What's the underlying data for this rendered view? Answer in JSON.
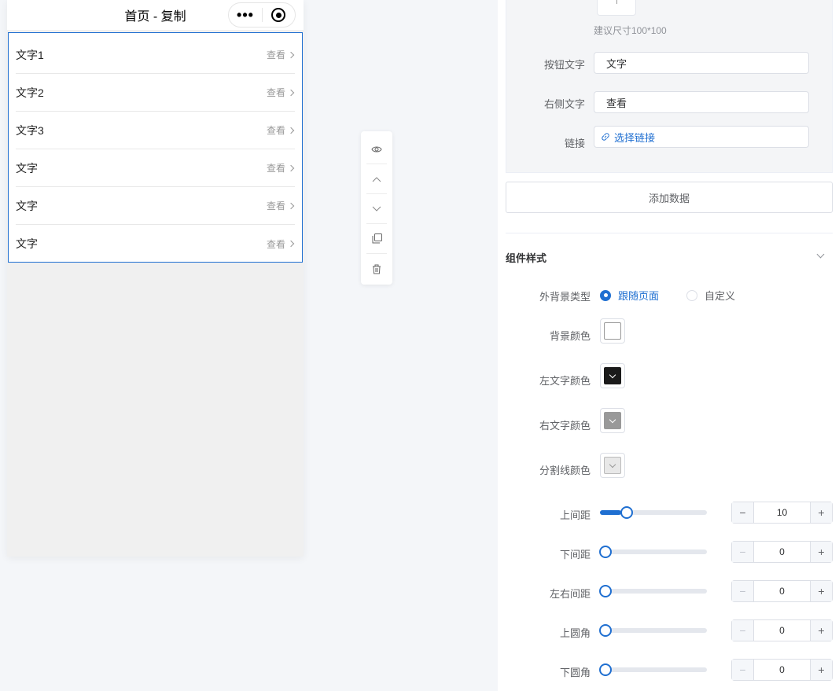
{
  "phone": {
    "title": "首页 - 复制",
    "more_glyph": "•••",
    "rows": [
      {
        "left": "文字1",
        "right": "查看"
      },
      {
        "left": "文字2",
        "right": "查看"
      },
      {
        "left": "文字3",
        "right": "查看"
      },
      {
        "left": "文字",
        "right": "查看"
      },
      {
        "left": "文字",
        "right": "查看"
      },
      {
        "left": "文字",
        "right": "查看"
      }
    ]
  },
  "toolbar": {
    "icons": [
      "eye-icon",
      "chevron-up-icon",
      "chevron-down-icon",
      "copy-icon",
      "trash-icon"
    ]
  },
  "panel": {
    "item": {
      "size_hint": "建议尺寸100*100",
      "button_text_label": "按钮文字",
      "button_text_value": "文字",
      "right_text_label": "右侧文字",
      "right_text_value": "查看",
      "link_label": "链接",
      "link_value": "选择链接"
    },
    "add_button": "添加数据",
    "style_section": {
      "title": "组件样式",
      "bg_type_label": "外背景类型",
      "bg_type_options": [
        "跟随页面",
        "自定义"
      ],
      "bg_type_selected": "跟随页面",
      "bg_color_label": "背景颜色",
      "left_text_color_label": "左文字颜色",
      "right_text_color_label": "右文字颜色",
      "divider_color_label": "分割线颜色",
      "colors": {
        "background": "#ffffff",
        "left_text": "#1a1a1a",
        "right_text": "#999999",
        "divider": "#e8e8e8"
      },
      "spacing": [
        {
          "label": "上间距",
          "value": "10",
          "fraction": 0.2
        },
        {
          "label": "下间距",
          "value": "0",
          "fraction": 0
        },
        {
          "label": "左右间距",
          "value": "0",
          "fraction": 0
        },
        {
          "label": "上圆角",
          "value": "0",
          "fraction": 0
        },
        {
          "label": "下圆角",
          "value": "0",
          "fraction": 0
        }
      ]
    }
  },
  "accent_color": "#1f6fd1"
}
